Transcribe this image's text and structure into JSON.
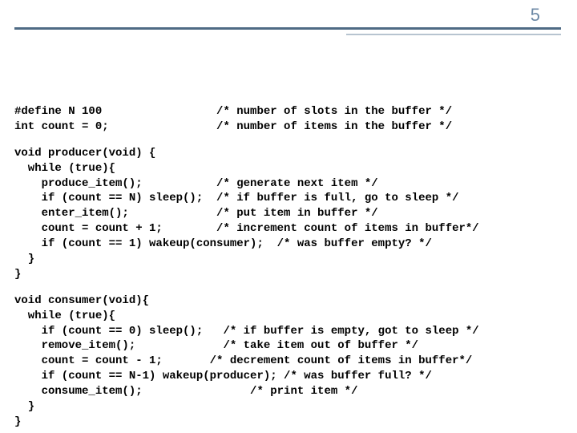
{
  "page_number": "5",
  "code": {
    "defs": "#define N 100                 /* number of slots in the buffer */\nint count = 0;                /* number of items in the buffer */",
    "producer": "void producer(void) {\n  while (true){\n    produce_item();           /* generate next item */\n    if (count == N) sleep();  /* if buffer is full, go to sleep */\n    enter_item();             /* put item in buffer */\n    count = count + 1;        /* increment count of items in buffer*/\n    if (count == 1) wakeup(consumer);  /* was buffer empty? */\n  }\n}",
    "consumer": "void consumer(void){\n  while (true){\n    if (count == 0) sleep();   /* if buffer is empty, got to sleep */\n    remove_item();             /* take item out of buffer */\n    count = count - 1;       /* decrement count of items in buffer*/\n    if (count == N-1) wakeup(producer); /* was buffer full? */\n    consume_item();                /* print item */\n  }\n}"
  }
}
